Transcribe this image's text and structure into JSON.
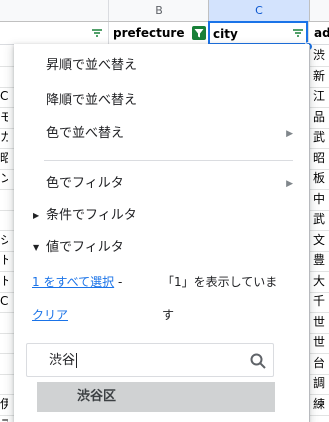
{
  "columns": {
    "b": "B",
    "c": "C"
  },
  "header_row": {
    "b": "prefecture",
    "c": "city",
    "d": "ad"
  },
  "rows": [
    {
      "a": "",
      "d": "渋"
    },
    {
      "a": "",
      "d": "新"
    },
    {
      "a": "C",
      "d": "江"
    },
    {
      "a": "モ",
      "d": "品"
    },
    {
      "a": "カ",
      "d": "武"
    },
    {
      "a": "昭",
      "d": "昭"
    },
    {
      "a": "ン",
      "d": "板"
    },
    {
      "a": "",
      "d": "中"
    },
    {
      "a": "",
      "d": "武"
    },
    {
      "a": "シ",
      "d": "文"
    },
    {
      "a": "ト",
      "d": "豊"
    },
    {
      "a": "ト",
      "d": "大"
    },
    {
      "a": "C",
      "d": "千"
    },
    {
      "a": "",
      "d": "世"
    },
    {
      "a": "",
      "d": "世"
    },
    {
      "a": "",
      "d": "台"
    },
    {
      "a": "",
      "d": "調"
    },
    {
      "a": "伊",
      "d": "練"
    },
    {
      "a": "ス",
      "d": ""
    }
  ],
  "menu": {
    "sort_asc": "昇順で並べ替え",
    "sort_desc": "降順で並べ替え",
    "sort_color": "色で並べ替え",
    "filter_color": "色でフィルタ",
    "filter_condition": "条件でフィルタ",
    "filter_values": "値でフィルタ",
    "select_all": "1 をすべて選択",
    "dash": "-",
    "clear": "クリア",
    "status_line1": "「1」を表示していま",
    "status_line2": "す",
    "search_value": "渋谷",
    "result_item": "渋谷区"
  },
  "icons": {
    "submenu": "triangle-right",
    "collapsed": "triangle-right",
    "expanded": "triangle-down",
    "search": "magnifier",
    "filter": "funnel"
  },
  "colors": {
    "link": "#1a73e8",
    "active_filter": "#188038",
    "selected_column": "#d3e3fd",
    "selection_border": "#1a73e8"
  }
}
